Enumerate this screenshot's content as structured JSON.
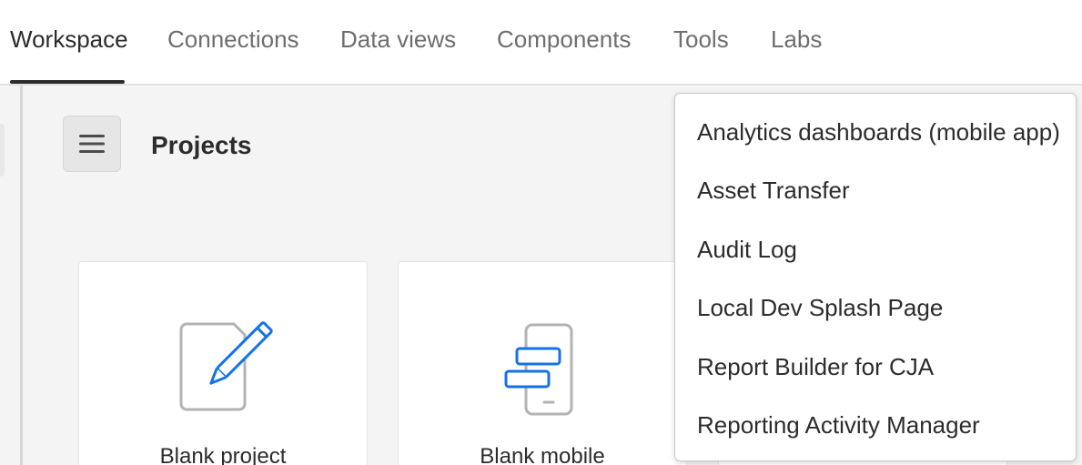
{
  "topnav": {
    "tabs": [
      {
        "label": "Workspace",
        "active": true
      },
      {
        "label": "Connections",
        "active": false
      },
      {
        "label": "Data views",
        "active": false
      },
      {
        "label": "Components",
        "active": false
      },
      {
        "label": "Tools",
        "active": false
      },
      {
        "label": "Labs",
        "active": false
      }
    ]
  },
  "page": {
    "title": "Projects",
    "menu_icon": "hamburger-menu-icon"
  },
  "cards": [
    {
      "label": "Blank project",
      "icon": "blank-project-icon"
    },
    {
      "label": "Blank mobile",
      "icon": "blank-mobile-icon"
    },
    {
      "label": "",
      "icon": ""
    }
  ],
  "dropdown": {
    "items": [
      "Analytics dashboards (mobile app)",
      "Asset Transfer",
      "Audit Log",
      "Local Dev Splash Page",
      "Report Builder for CJA",
      "Reporting Activity Manager"
    ]
  },
  "colors": {
    "accent_blue": "#1473e6",
    "icon_gray": "#b3b3b3",
    "text": "#2c2c2c",
    "muted_text": "#6e6e6e",
    "background": "#f4f4f4"
  }
}
